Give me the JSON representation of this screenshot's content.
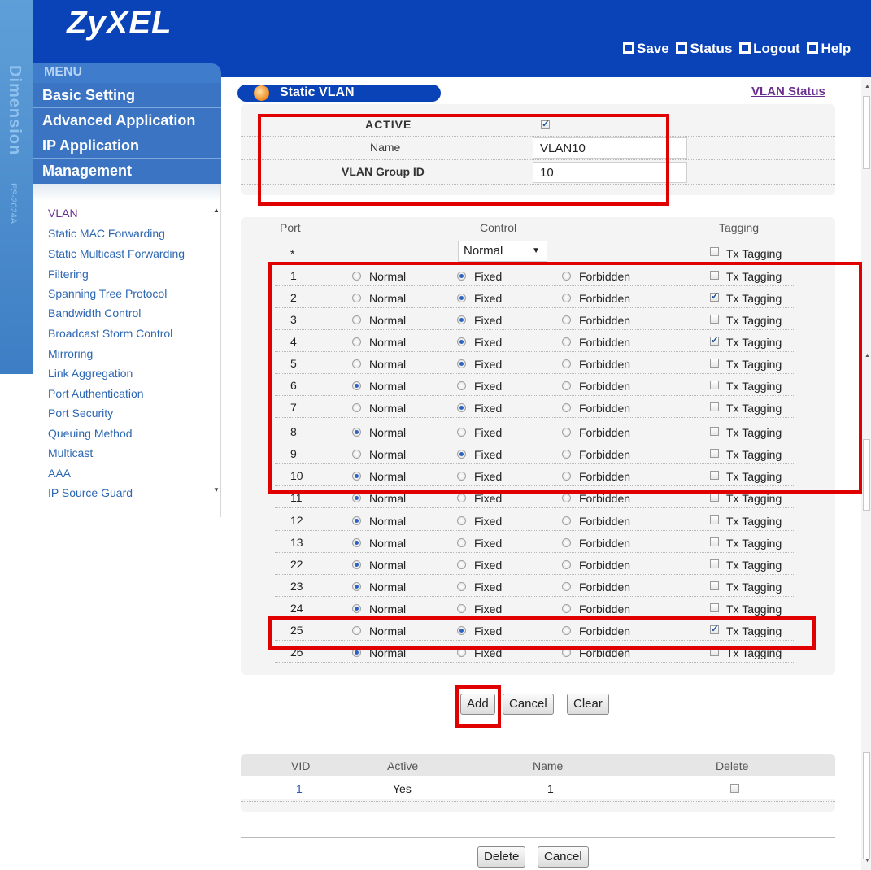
{
  "brand": {
    "logo": "ZyXEL",
    "side_text": "Dimension",
    "model": "ES-2024A"
  },
  "toplinks": [
    "Save",
    "Status",
    "Logout",
    "Help"
  ],
  "menu": {
    "head": "MENU",
    "main": [
      "Basic Setting",
      "Advanced Application",
      "IP Application",
      "Management"
    ],
    "sub": [
      "VLAN",
      "Static MAC Forwarding",
      "Static Multicast Forwarding",
      "Filtering",
      "Spanning Tree Protocol",
      "Bandwidth Control",
      "Broadcast Storm Control",
      "Mirroring",
      "Link Aggregation",
      "Port Authentication",
      "Port Security",
      "Queuing Method",
      "Multicast",
      "AAA",
      "IP Source Guard"
    ]
  },
  "page": {
    "title": "Static VLAN",
    "status_link": "VLAN Status"
  },
  "form": {
    "active_label": "ACTIVE",
    "active": true,
    "name_label": "Name",
    "name_value": "VLAN10",
    "gid_label": "VLAN Group ID",
    "gid_value": "10"
  },
  "table": {
    "headers": {
      "port": "Port",
      "control": "Control",
      "tagging": "Tagging"
    },
    "all_row": {
      "port": "*",
      "control": "Normal",
      "tag_label": "Tx Tagging"
    },
    "options": [
      "Normal",
      "Fixed",
      "Forbidden"
    ],
    "tag_label": "Tx Tagging",
    "rows": [
      {
        "port": "1",
        "control": "Fixed",
        "tag": false
      },
      {
        "port": "2",
        "control": "Fixed",
        "tag": true
      },
      {
        "port": "3",
        "control": "Fixed",
        "tag": false
      },
      {
        "port": "4",
        "control": "Fixed",
        "tag": true
      },
      {
        "port": "5",
        "control": "Fixed",
        "tag": false
      },
      {
        "port": "6",
        "control": "Normal",
        "tag": false
      },
      {
        "port": "7",
        "control": "Fixed",
        "tag": false
      },
      {
        "port": "8",
        "control": "Normal",
        "tag": false
      },
      {
        "port": "9",
        "control": "Fixed",
        "tag": false
      },
      {
        "port": "10",
        "control": "Normal",
        "tag": false
      },
      {
        "port": "11",
        "control": "Normal",
        "tag": false
      },
      {
        "port": "12",
        "control": "Normal",
        "tag": false
      },
      {
        "port": "13",
        "control": "Normal",
        "tag": false
      },
      {
        "port": "22",
        "control": "Normal",
        "tag": false
      },
      {
        "port": "23",
        "control": "Normal",
        "tag": false
      },
      {
        "port": "24",
        "control": "Normal",
        "tag": false
      },
      {
        "port": "25",
        "control": "Fixed",
        "tag": true
      },
      {
        "port": "26",
        "control": "Normal",
        "tag": false
      }
    ]
  },
  "buttons": {
    "add": "Add",
    "cancel": "Cancel",
    "clear": "Clear",
    "delete": "Delete",
    "cancel2": "Cancel"
  },
  "summary": {
    "headers": [
      "VID",
      "Active",
      "Name",
      "Delete"
    ],
    "rows": [
      {
        "vid": "1",
        "active": "Yes",
        "name": "1",
        "delete": false
      }
    ]
  },
  "colors": {
    "banner": "#0a43b8",
    "menu": "#3a74c2",
    "highlight": "#e00000",
    "visited": "#6a2e8f"
  }
}
